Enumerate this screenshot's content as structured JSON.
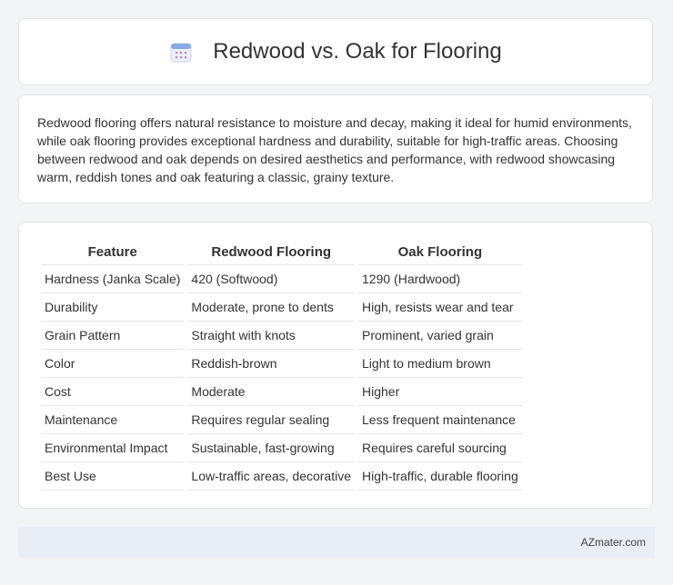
{
  "header": {
    "title": "Redwood vs. Oak for Flooring",
    "icon": "calendar-icon"
  },
  "intro": {
    "text": "Redwood flooring offers natural resistance to moisture and decay, making it ideal for humid environments, while oak flooring provides exceptional hardness and durability, suitable for high-traffic areas. Choosing between redwood and oak depends on desired aesthetics and performance, with redwood showcasing warm, reddish tones and oak featuring a classic, grainy texture."
  },
  "table": {
    "headers": [
      "Feature",
      "Redwood Flooring",
      "Oak Flooring"
    ],
    "rows": [
      [
        "Hardness (Janka Scale)",
        "420 (Softwood)",
        "1290 (Hardwood)"
      ],
      [
        "Durability",
        "Moderate, prone to dents",
        "High, resists wear and tear"
      ],
      [
        "Grain Pattern",
        "Straight with knots",
        "Prominent, varied grain"
      ],
      [
        "Color",
        "Reddish-brown",
        "Light to medium brown"
      ],
      [
        "Cost",
        "Moderate",
        "Higher"
      ],
      [
        "Maintenance",
        "Requires regular sealing",
        "Less frequent maintenance"
      ],
      [
        "Environmental Impact",
        "Sustainable, fast-growing",
        "Requires careful sourcing"
      ],
      [
        "Best Use",
        "Low-traffic areas, decorative",
        "High-traffic, durable flooring"
      ]
    ]
  },
  "footer": {
    "text": "AZmater.com"
  },
  "colors": {
    "background": "#f3f4f6",
    "card": "#ffffff",
    "footer": "#e8edf6",
    "icon_accent": "#8aa8e8"
  }
}
